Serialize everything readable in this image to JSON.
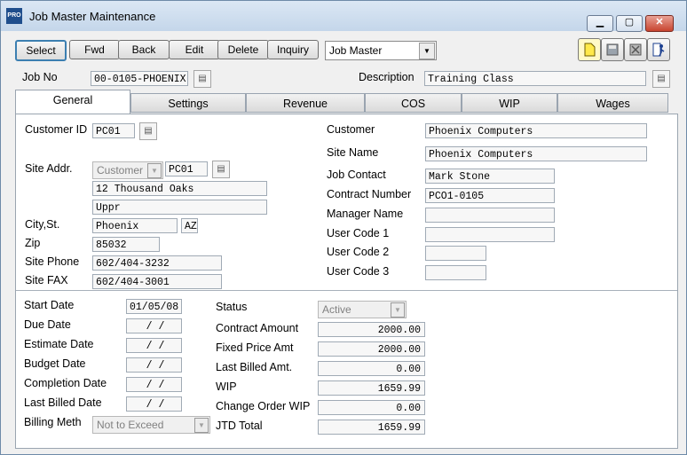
{
  "window": {
    "app_icon": "PRO",
    "title": "Job Master Maintenance"
  },
  "toolbar": {
    "buttons": [
      "Select",
      "Fwd",
      "Back",
      "Edit",
      "Delete",
      "Inquiry"
    ],
    "mode_select": "Job Master",
    "icons": [
      "new-doc-icon",
      "save-icon",
      "delete-doc-icon",
      "exit-icon"
    ]
  },
  "header": {
    "job_no_label": "Job No",
    "job_no": "00-0105-PHOENIX",
    "description_label": "Description",
    "description": "Training Class"
  },
  "tabs": [
    "General",
    "Settings",
    "Revenue",
    "COS",
    "WIP",
    "Wages"
  ],
  "general": {
    "customer_id_label": "Customer ID",
    "customer_id": "PC01",
    "site_addr_label": "Site Addr.",
    "site_addr_type": "Customer",
    "site_addr_code": "PC01",
    "addr1": "12 Thousand Oaks",
    "addr2": "Uppr",
    "city_label": "City,St.",
    "city": "Phoenix",
    "state": "AZ",
    "zip_label": "Zip",
    "zip": "85032",
    "site_phone_label": "Site Phone",
    "site_phone": "602/404-3232",
    "site_fax_label": "Site FAX",
    "site_fax": "602/404-3001",
    "customer_label": "Customer",
    "customer": "Phoenix Computers",
    "site_name_label": "Site Name",
    "site_name": "Phoenix Computers",
    "job_contact_label": "Job Contact",
    "job_contact": "Mark Stone",
    "contract_number_label": "Contract Number",
    "contract_number": "PCO1-0105",
    "manager_name_label": "Manager Name",
    "manager_name": "",
    "user_code1_label": "User Code 1",
    "user_code1": "",
    "user_code2_label": "User Code 2",
    "user_code2": "",
    "user_code3_label": "User Code 3",
    "user_code3": ""
  },
  "dates": {
    "start_label": "Start Date",
    "start": "01/05/08",
    "due_label": "Due Date",
    "due": " /  /",
    "estimate_label": "Estimate Date",
    "estimate": " /  /",
    "budget_label": "Budget Date",
    "budget": " /  /",
    "completion_label": "Completion Date",
    "completion": " /  /",
    "last_billed_label": "Last Billed Date",
    "last_billed": " /  /",
    "billing_meth_label": "Billing Meth",
    "billing_meth": "Not to Exceed"
  },
  "amounts": {
    "status_label": "Status",
    "status": "Active",
    "contract_amount_label": "Contract Amount",
    "contract_amount": "2000.00",
    "fixed_price_label": "Fixed Price Amt",
    "fixed_price": "2000.00",
    "last_billed_amt_label": "Last Billed Amt.",
    "last_billed_amt": "0.00",
    "wip_label": "WIP",
    "wip": "1659.99",
    "change_order_label": "Change Order WIP",
    "change_order": "0.00",
    "jtd_total_label": "JTD Total",
    "jtd_total": "1659.99"
  }
}
